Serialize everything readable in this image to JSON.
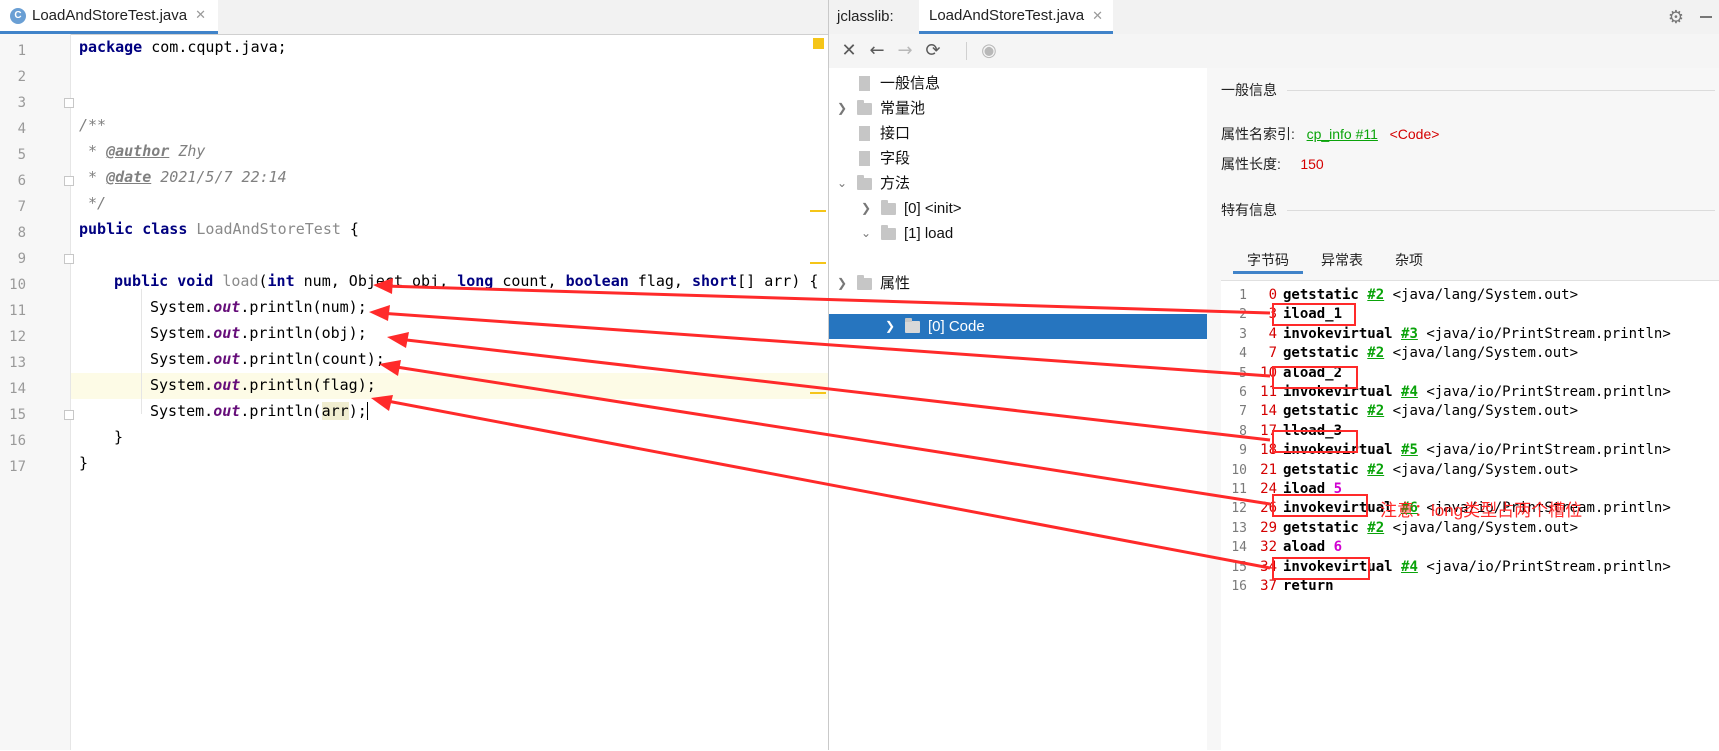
{
  "editor": {
    "tab_label": "LoadAndStoreTest.java",
    "tab_icon_letter": "C",
    "line_numbers": [
      "1",
      "2",
      "3",
      "4",
      "5",
      "6",
      "7",
      "8",
      "9",
      "10",
      "11",
      "12",
      "13",
      "14",
      "15",
      "16",
      "17"
    ],
    "code": {
      "l1_kw": "package",
      "l1_rest": " com.cqupt.java;",
      "l3": "/**",
      "l4_star": " * ",
      "l4_tag": "@author",
      "l4_val": " Zhy",
      "l5_star": " * ",
      "l5_tag": "@date",
      "l5_val": " 2021/5/7 22:14",
      "l6": " */",
      "l7_kw": "public class",
      "l7_name": " LoadAndStoreTest",
      "l7_rest": " {",
      "l9_kw1": "public void",
      "l9_name": " load",
      "l9_p1": "(",
      "l9_kw2": "int",
      "l9_p2": " num, Object obj, ",
      "l9_kw3": "long",
      "l9_p3": " count, ",
      "l9_kw4": "boolean",
      "l9_p4": " flag, ",
      "l9_kw5": "short",
      "l9_p5": "[] arr) {",
      "print_prefix": "System.",
      "print_field": "out",
      "l10_rest": ".println(num);",
      "l11_rest": ".println(obj);",
      "l12_rest": ".println(count);",
      "l13_rest": ".println(flag);",
      "l14_mid": ".println(",
      "l14_arg": "arr",
      "l14_end": ");",
      "l15": "}",
      "l16": "}"
    }
  },
  "jclasslib": {
    "title": "jclasslib:",
    "tab_label": "LoadAndStoreTest.java",
    "tree": [
      {
        "label": "一般信息"
      },
      {
        "label": "常量池"
      },
      {
        "label": "接口"
      },
      {
        "label": "字段"
      },
      {
        "label": "方法"
      },
      {
        "label": "[0] <init>"
      },
      {
        "label": "[1] load"
      },
      {
        "label": "[0] Code"
      },
      {
        "label": "属性"
      }
    ],
    "general_title": "一般信息",
    "attr_name_label": "属性名索引:",
    "attr_name_link": "cp_info #11",
    "attr_name_value": "<Code>",
    "attr_len_label": "属性长度:",
    "attr_len_value": "150",
    "specific_title": "特有信息",
    "bytecode_tabs": [
      "字节码",
      "异常表",
      "杂项"
    ],
    "bytecode": [
      {
        "ln": "1",
        "off": "0",
        "op": "getstatic",
        "ref": "#2",
        "cls": "<java/lang/System.out>"
      },
      {
        "ln": "2",
        "off": "3",
        "op": "iload_1",
        "ref": "",
        "cls": ""
      },
      {
        "ln": "3",
        "off": "4",
        "op": "invokevirtual",
        "ref": "#3",
        "cls": "<java/io/PrintStream.println>"
      },
      {
        "ln": "4",
        "off": "7",
        "op": "getstatic",
        "ref": "#2",
        "cls": "<java/lang/System.out>"
      },
      {
        "ln": "5",
        "off": "10",
        "op": "aload_2",
        "ref": "",
        "cls": ""
      },
      {
        "ln": "6",
        "off": "11",
        "op": "invokevirtual",
        "ref": "#4",
        "cls": "<java/io/PrintStream.println>"
      },
      {
        "ln": "7",
        "off": "14",
        "op": "getstatic",
        "ref": "#2",
        "cls": "<java/lang/System.out>"
      },
      {
        "ln": "8",
        "off": "17",
        "op": "lload_3",
        "ref": "",
        "cls": ""
      },
      {
        "ln": "9",
        "off": "18",
        "op": "invokevirtual",
        "ref": "#5",
        "cls": "<java/io/PrintStream.println>"
      },
      {
        "ln": "10",
        "off": "21",
        "op": "getstatic",
        "ref": "#2",
        "cls": "<java/lang/System.out>"
      },
      {
        "ln": "11",
        "off": "24",
        "op": "iload",
        "ref": "",
        "cls": "",
        "idx": "5"
      },
      {
        "ln": "12",
        "off": "26",
        "op": "invokevirtual",
        "ref": "#6",
        "cls": "<java/io/PrintStream.println>"
      },
      {
        "ln": "13",
        "off": "29",
        "op": "getstatic",
        "ref": "#2",
        "cls": "<java/lang/System.out>"
      },
      {
        "ln": "14",
        "off": "32",
        "op": "aload",
        "ref": "",
        "cls": "",
        "idx": "6"
      },
      {
        "ln": "15",
        "off": "34",
        "op": "invokevirtual",
        "ref": "#4",
        "cls": "<java/io/PrintStream.println>"
      },
      {
        "ln": "16",
        "off": "37",
        "op": "return",
        "ref": "",
        "cls": ""
      }
    ],
    "annotation_note": "注意：long类型占两个槽位"
  },
  "colors": {
    "accent": "#4083c9",
    "selection": "#2675bf",
    "annotation": "#ff2a2a",
    "link": "#0aa30a",
    "keyword": "#000080"
  }
}
